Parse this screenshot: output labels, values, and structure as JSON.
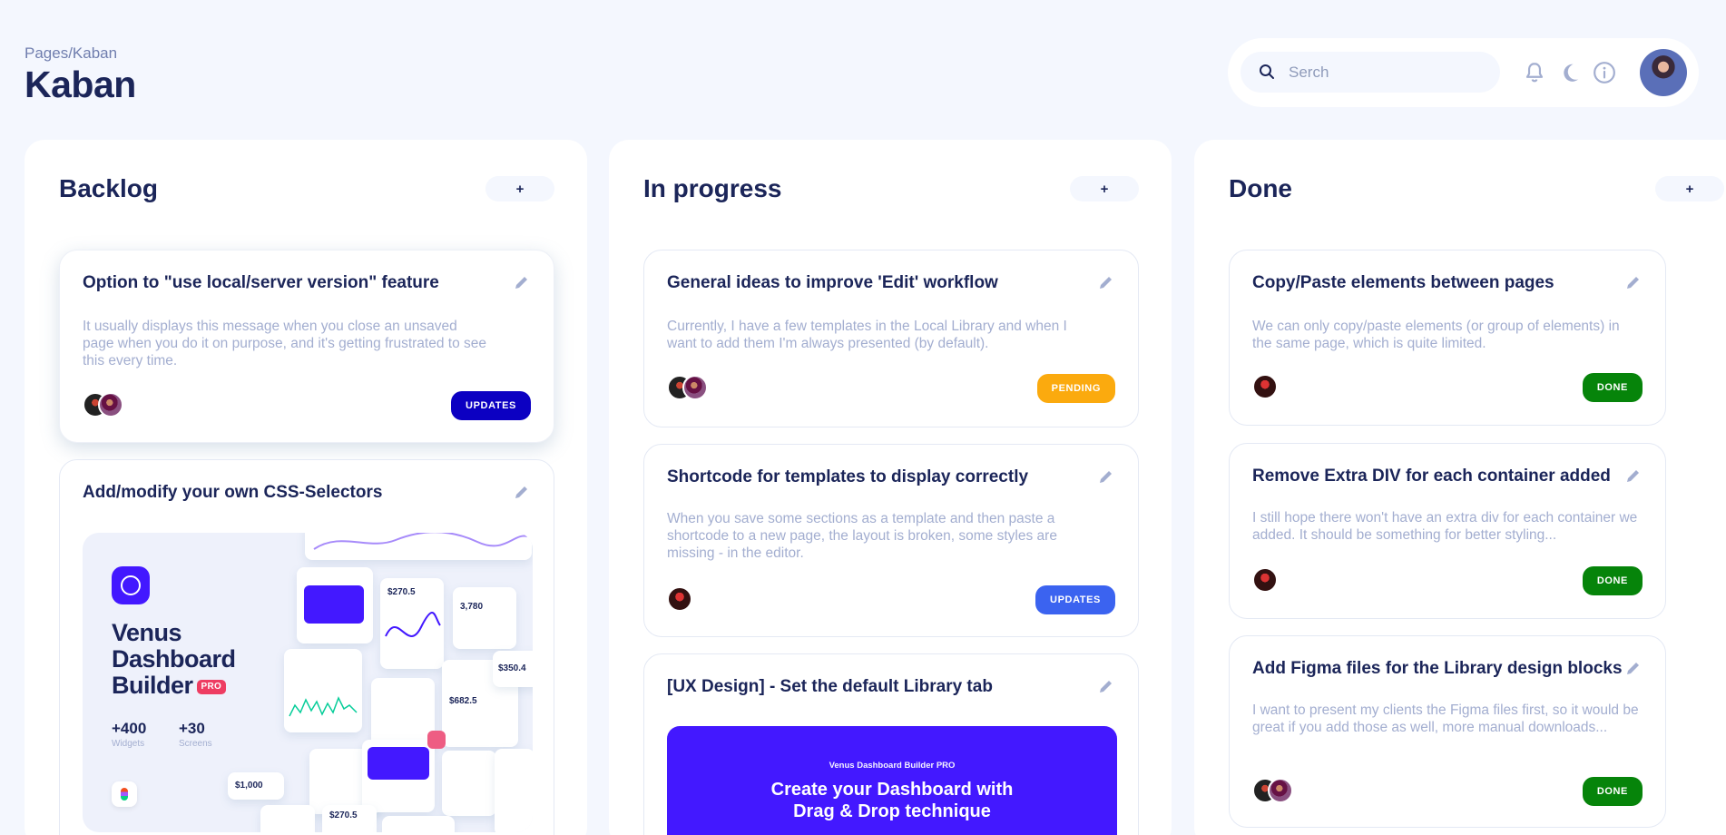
{
  "header": {
    "breadcrumb": "Pages/Kaban",
    "title": "Kaban"
  },
  "topbar": {
    "search_placeholder": "Serch",
    "icons": [
      "search-icon",
      "bell-icon",
      "moon-icon",
      "info-icon",
      "avatar"
    ]
  },
  "columns": [
    {
      "title": "Backlog",
      "add_label": "+",
      "cards": [
        {
          "title": "Option to \"use local/server version\" feature",
          "description": "It usually displays this message when you close an unsaved page when you do it on purpose, and it's getting frustrated to see this every time.",
          "badge": "UPDATES"
        },
        {
          "title": "Add/modify your own CSS-Selectors",
          "promo": {
            "title": "Venus Dashboard Builder",
            "pro": "PRO",
            "stats": [
              {
                "value": "+400",
                "label": "Widgets"
              },
              {
                "value": "+30",
                "label": "Screens"
              }
            ],
            "mock_values": [
              "$270.5",
              "$682.5",
              "3,780",
              "$350.4",
              "$1,000",
              "$270.5"
            ]
          }
        }
      ]
    },
    {
      "title": "In progress",
      "add_label": "+",
      "cards": [
        {
          "title": "General ideas to improve 'Edit' workflow",
          "description": "Currently, I have a few templates in the Local Library and when I want to add them I'm always presented (by default).",
          "badge": "PENDING"
        },
        {
          "title": "Shortcode for templates to display correctly",
          "description": "When you save some sections as a template and then paste a shortcode to a new page, the layout is broken, some styles are missing - in the editor.",
          "badge": "UPDATES"
        },
        {
          "title": "[UX Design] - Set the default Library tab",
          "promo": {
            "subtitle": "Venus Dashboard Builder PRO",
            "headline_1": "Create your Dashboard with",
            "headline_2": "Drag & Drop technique"
          }
        }
      ]
    },
    {
      "title": "Done",
      "add_label": "+",
      "cards": [
        {
          "title": "Copy/Paste elements between pages",
          "description": "We can only copy/paste elements (or group of elements) in the same page, which is quite limited.",
          "badge": "DONE"
        },
        {
          "title": "Remove Extra DIV for each container added",
          "description": "I still hope there won't have an extra div for each container we added. It should be something for better styling...",
          "badge": "DONE"
        },
        {
          "title": "Add Figma files for the Library design blocks",
          "description": "I want to present my clients the Figma files first, so it would be great if you add those as well, more manual downloads...",
          "badge": "DONE"
        }
      ]
    }
  ],
  "colors": {
    "background": "#f4f7fe",
    "navy": "#1b2559",
    "updates_dark": "#0c00c2",
    "updates": "#3b63f0",
    "pending": "#fbaa0e",
    "done": "#06840a",
    "brand": "#4318ff"
  }
}
